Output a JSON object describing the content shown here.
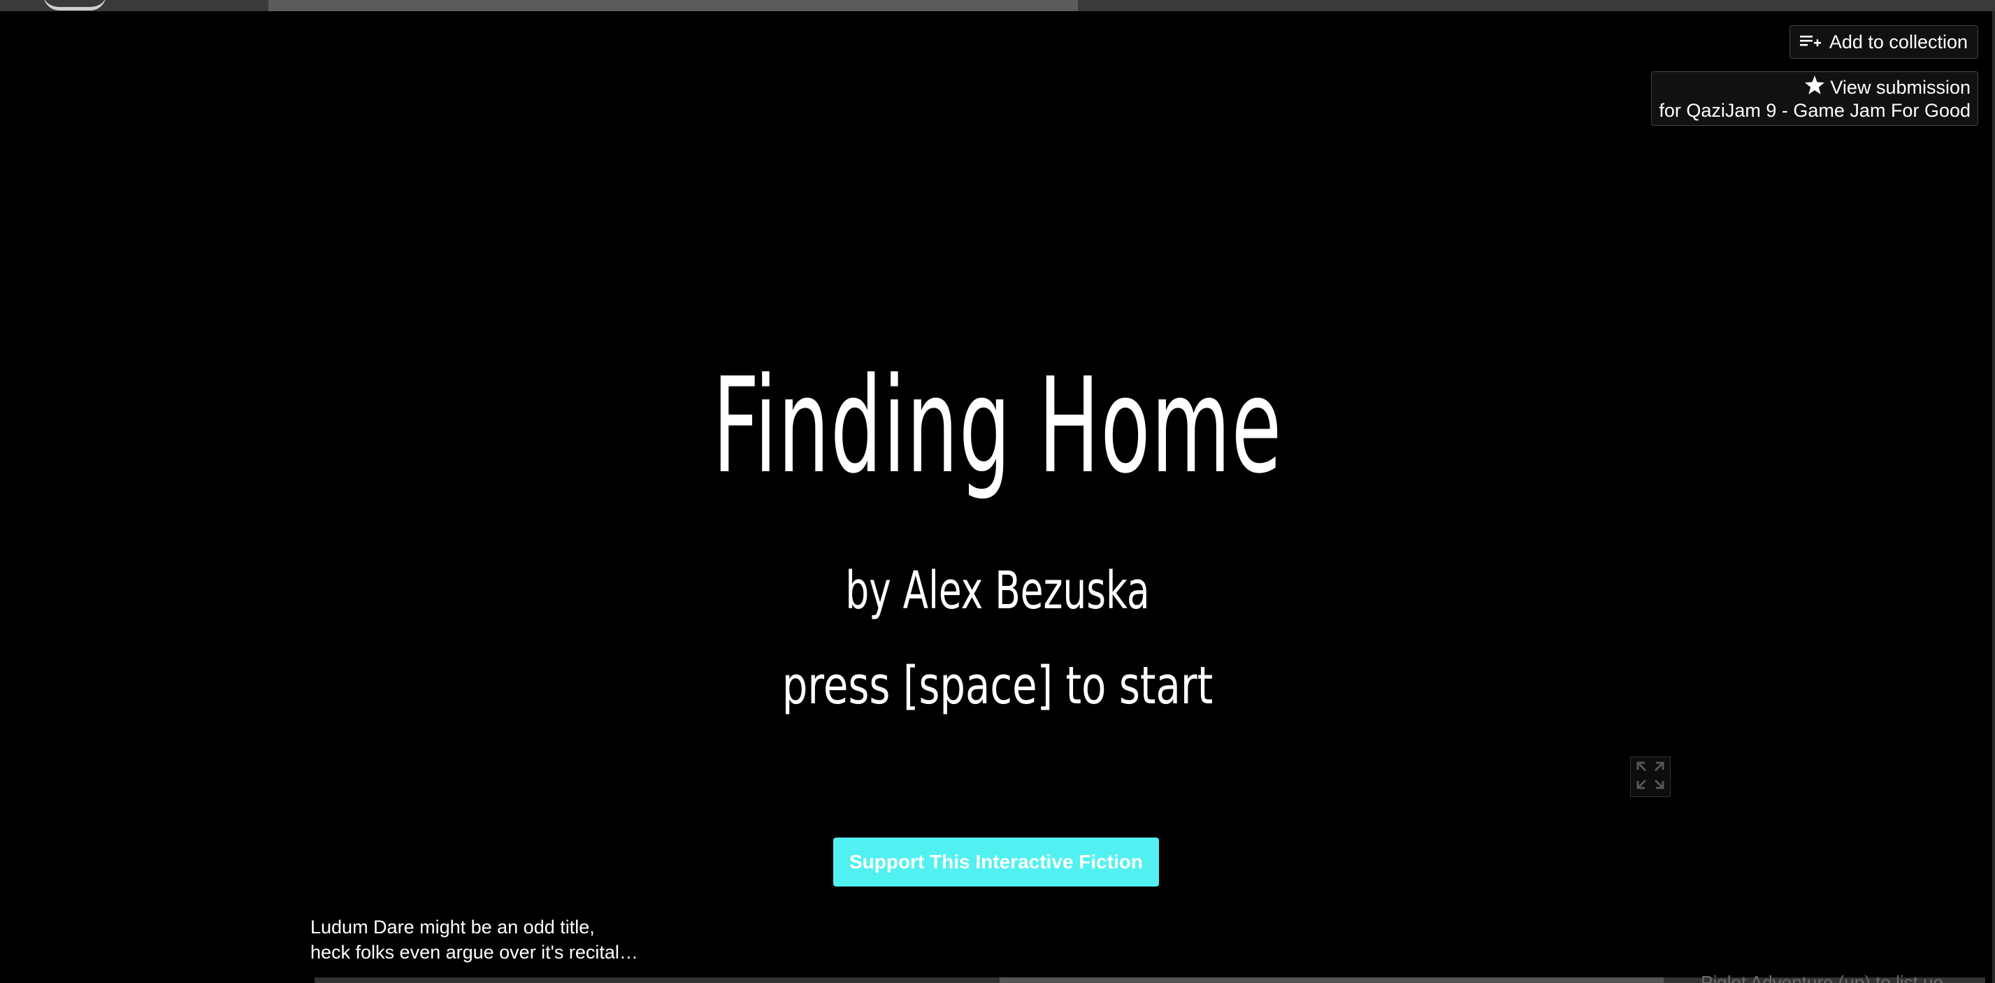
{
  "buttons": {
    "add_to_collection": "Add to collection",
    "view_submission": "View submission",
    "submission_for": "for QaziJam 9 - Game Jam For Good"
  },
  "game": {
    "title": "Finding Home",
    "author": "by Alex Bezuska",
    "prompt": "press [space] to start"
  },
  "support": {
    "label": "Support This Interactive Fiction",
    "color": "#52f1f1"
  },
  "description": {
    "line1": "Ludum Dare might be an odd title,",
    "line2": "heck folks even argue over it's recital…"
  },
  "cut_off_text": "Piglet Adventure (up) to list ue",
  "icons": {
    "collection": "playlist-add-icon",
    "submission": "star-icon",
    "fullscreen": "fullscreen-icon"
  }
}
